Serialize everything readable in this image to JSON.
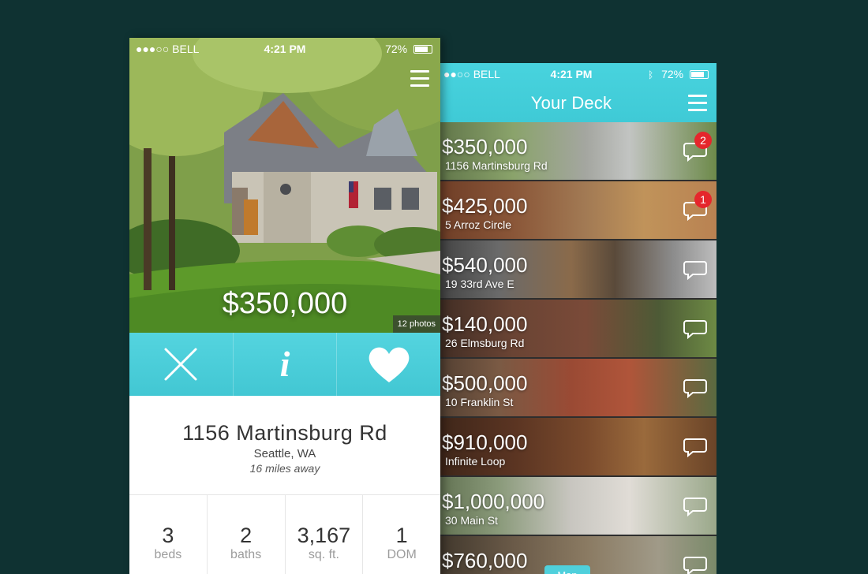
{
  "deck_screen": {
    "status": {
      "carrier": "●●○○ BELL",
      "time": "4:21 PM",
      "battery": "72%"
    },
    "title": "Your Deck",
    "listings": [
      {
        "price": "$350,000",
        "address": "1156 Martinsburg Rd",
        "badge": "2"
      },
      {
        "price": "$425,000",
        "address": "5 Arroz Circle",
        "badge": "1"
      },
      {
        "price": "$540,000",
        "address": "19 33rd Ave E",
        "badge": ""
      },
      {
        "price": "$140,000",
        "address": "26 Elmsburg Rd",
        "badge": ""
      },
      {
        "price": "$500,000",
        "address": "10 Franklin St",
        "badge": ""
      },
      {
        "price": "$910,000",
        "address": "Infinite Loop",
        "badge": ""
      },
      {
        "price": "$1,000,000",
        "address": "30 Main St",
        "badge": ""
      },
      {
        "price": "$760,000",
        "address": "",
        "badge": ""
      }
    ],
    "map_button": "Map"
  },
  "listing_screen": {
    "status": {
      "carrier": "●●●○○ BELL",
      "time": "4:21 PM",
      "battery": "72%"
    },
    "price": "$350,000",
    "photos_count": "12 photos",
    "address": "1156 Martinsburg Rd",
    "city": "Seattle, WA",
    "distance": "16 miles away",
    "stats": [
      {
        "value": "3",
        "label": "beds"
      },
      {
        "value": "2",
        "label": "baths"
      },
      {
        "value": "3,167",
        "label": "sq. ft."
      },
      {
        "value": "1",
        "label": "DOM"
      }
    ]
  },
  "colors": {
    "background": "#0f3232",
    "accent": "#48d3de",
    "badge": "#e5262c"
  }
}
